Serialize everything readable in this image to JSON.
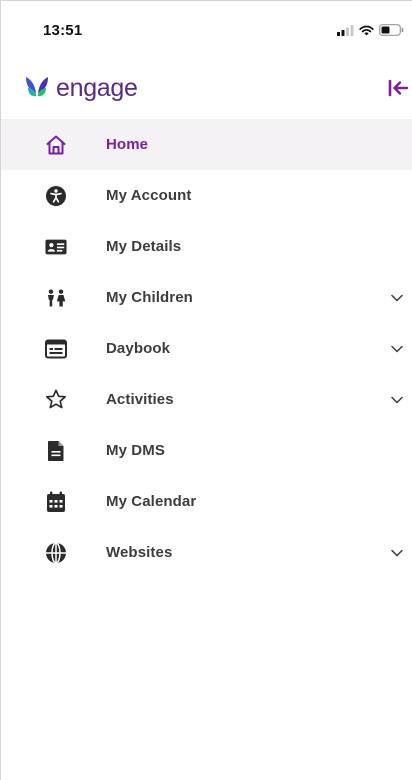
{
  "status_bar": {
    "time": "13:51",
    "icons": [
      "signal-icon",
      "wifi-icon",
      "battery-icon"
    ]
  },
  "header": {
    "logo_text": "engage",
    "collapse_icon": "collapse-left-icon"
  },
  "nav": {
    "items": [
      {
        "label": "Home",
        "icon": "home-icon",
        "active": true,
        "expandable": false
      },
      {
        "label": "My Account",
        "icon": "accessibility-icon",
        "active": false,
        "expandable": false
      },
      {
        "label": "My Details",
        "icon": "id-card-icon",
        "active": false,
        "expandable": false
      },
      {
        "label": "My Children",
        "icon": "children-icon",
        "active": false,
        "expandable": true
      },
      {
        "label": "Daybook",
        "icon": "daybook-icon",
        "active": false,
        "expandable": true
      },
      {
        "label": "Activities",
        "icon": "star-icon",
        "active": false,
        "expandable": true
      },
      {
        "label": "My DMS",
        "icon": "document-icon",
        "active": false,
        "expandable": false
      },
      {
        "label": "My Calendar",
        "icon": "calendar-icon",
        "active": false,
        "expandable": false
      },
      {
        "label": "Websites",
        "icon": "globe-icon",
        "active": false,
        "expandable": true
      }
    ]
  },
  "colors": {
    "accent": "#7b1fa2",
    "logo_text": "#5b2a86",
    "active_bg": "#f4f2f4",
    "label": "#3d3d3d",
    "icon": "#2b2b2b"
  }
}
